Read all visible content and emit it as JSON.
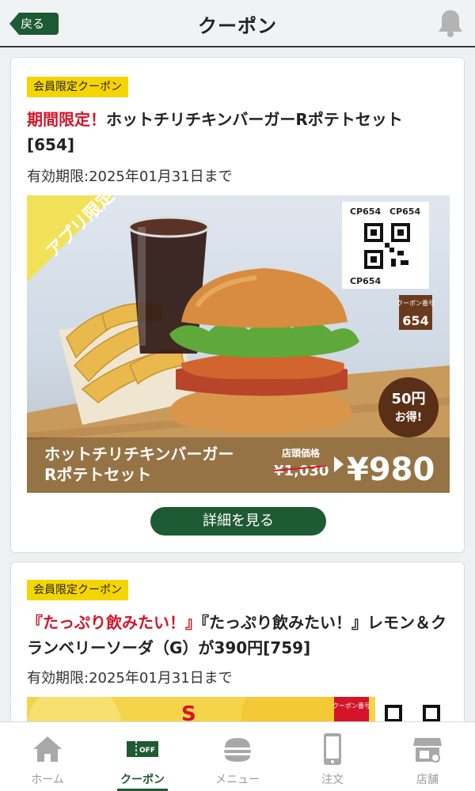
{
  "header": {
    "back_label": "戻る",
    "title": "クーポン"
  },
  "coupons": [
    {
      "tag": "会員限定クーポン",
      "title_highlight": "期間限定！",
      "title": "ホットチリチキンバーガーRポテトセット",
      "title_code": "[654]",
      "expiry": "有効期限:2025年01月31日まで",
      "image": {
        "badge": "アプリ限定",
        "qr_code_text": "CP654",
        "coupon_no_label": "クーポン番号",
        "coupon_no": "654",
        "discount_line1": "50円",
        "discount_line2": "お得!",
        "product_name_line1": "ホットチリチキンバーガー",
        "product_name_line2": "Rポテトセット",
        "store_price_label": "店頭価格",
        "store_price": "¥1,030",
        "price": "¥980"
      },
      "detail_button": "詳細を見る"
    },
    {
      "tag": "会員限定クーポン",
      "title_highlight": "『たっぷり飲みたい！』",
      "title": "『たっぷり飲みたい！』レモン＆クランベリーソーダ（G）が390円[759]",
      "expiry": "有効期限:2025年01月31日まで",
      "image": {
        "coupon_no_label": "クーポン番号"
      }
    }
  ],
  "nav": [
    {
      "label": "ホーム",
      "icon": "home-icon",
      "active": false
    },
    {
      "label": "クーポン",
      "icon": "coupon-icon",
      "active": true
    },
    {
      "label": "メニュー",
      "icon": "burger-icon",
      "active": false
    },
    {
      "label": "注文",
      "icon": "phone-icon",
      "active": false
    },
    {
      "label": "店舗",
      "icon": "store-icon",
      "active": false
    }
  ],
  "colors": {
    "brand_green": "#1e5a33",
    "tag_yellow": "#f5d500",
    "highlight_red": "#d41428"
  }
}
